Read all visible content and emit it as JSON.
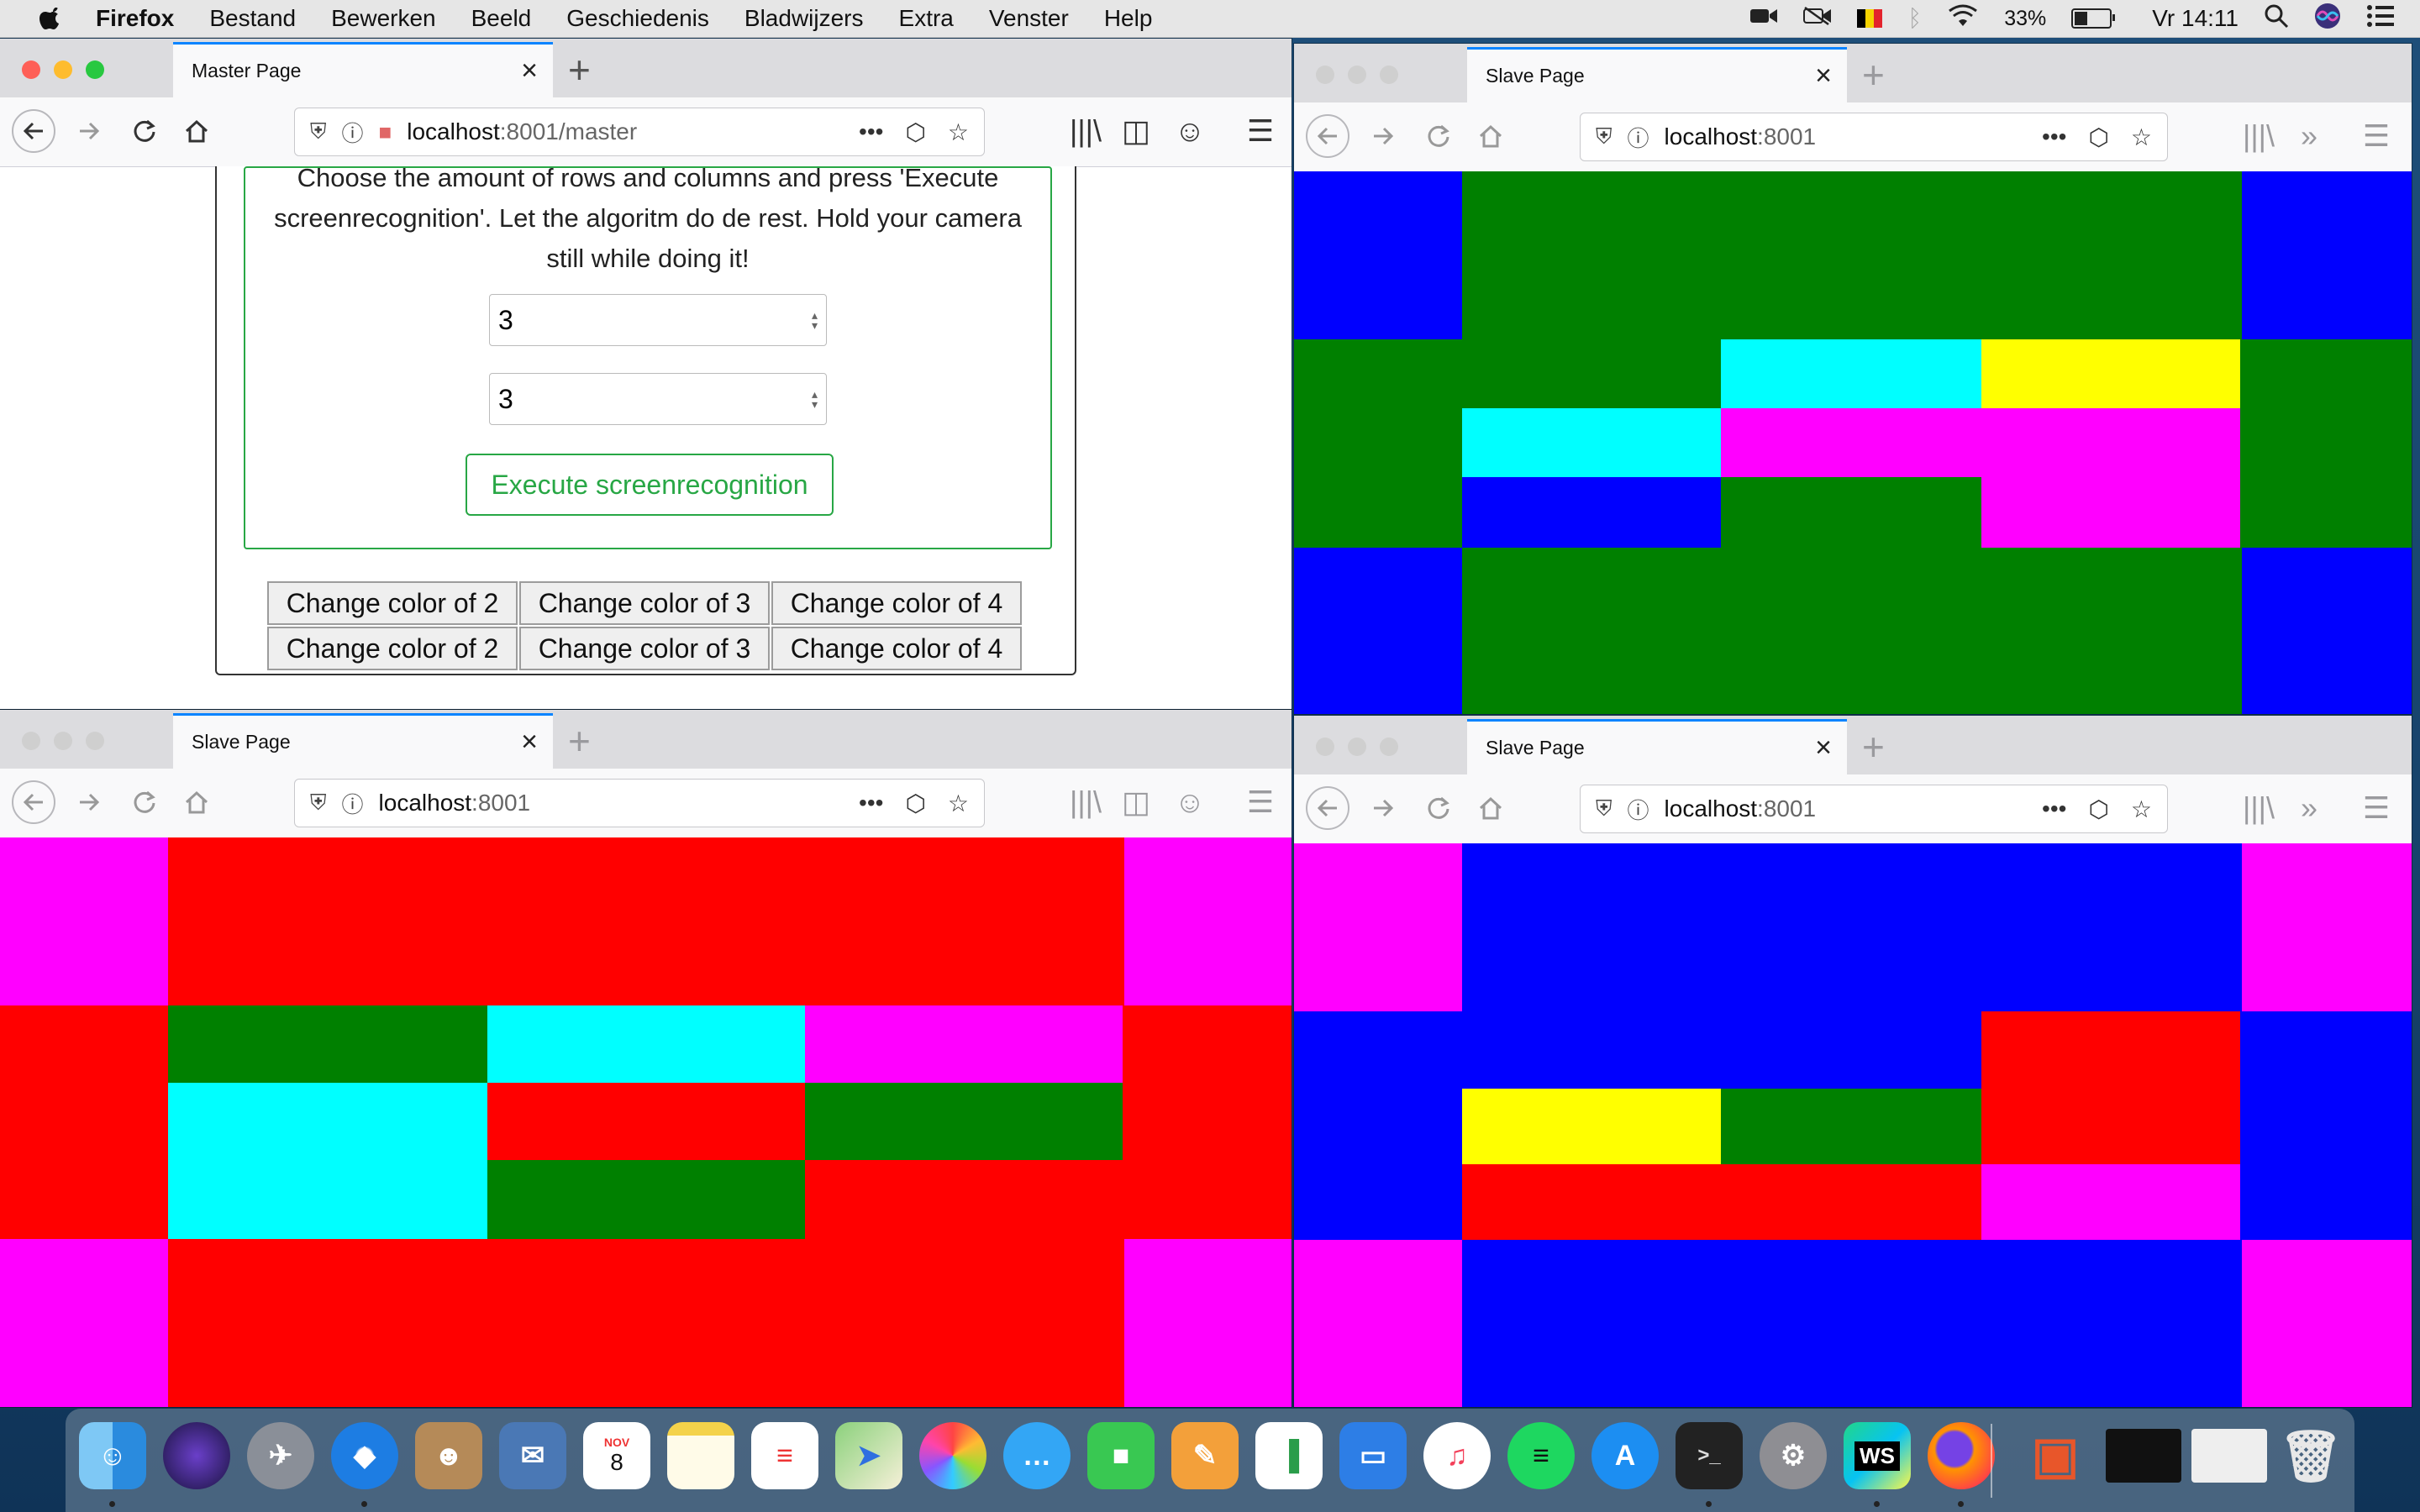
{
  "menubar": {
    "app": "Firefox",
    "items": [
      "Bestand",
      "Bewerken",
      "Beeld",
      "Geschiedenis",
      "Bladwijzers",
      "Extra",
      "Venster",
      "Help"
    ],
    "battery": "33%",
    "clock": "Vr 14:11"
  },
  "windows": {
    "master": {
      "tab_title": "Master Page",
      "url_host": "localhost",
      "url_rest": ":8001/master",
      "instructions_line1": "Choose the amount of rows and columns and press 'Execute",
      "instructions_line2": "screenrecognition'. Let the algoritm do de rest. Hold your camera",
      "instructions_line3": "still while doing it!",
      "rows_value": "3",
      "cols_value": "3",
      "execute_label": "Execute screenrecognition",
      "color_buttons": [
        "Change color of 2",
        "Change color of 3",
        "Change color of 4",
        "Change color of 2",
        "Change color of 3",
        "Change color of 4"
      ]
    },
    "slave_top_right": {
      "tab_title": "Slave Page",
      "url_host": "localhost",
      "url_rest": ":8001",
      "colors": {
        "blue": "#0000ff",
        "green": "#008000",
        "cyan": "#00ffff",
        "yellow": "#ffff00",
        "magenta": "#ff00ff",
        "red": "#ff0000"
      }
    },
    "slave_bottom_left": {
      "tab_title": "Slave Page",
      "url_host": "localhost",
      "url_rest": ":8001"
    },
    "slave_bottom_right": {
      "tab_title": "Slave Page",
      "url_host": "localhost",
      "url_rest": ":8001"
    }
  },
  "dock": {
    "apps": [
      "Finder",
      "Siri",
      "Launchpad",
      "Safari",
      "Contacts",
      "Mail",
      "Calendar",
      "Notes",
      "Reminders",
      "Maps",
      "Photos",
      "Messages",
      "FaceTime",
      "Pages",
      "Numbers",
      "Keynote",
      "Music",
      "Spotify",
      "App Store",
      "Terminal",
      "System Preferences",
      "WebStorm",
      "Firefox",
      "Office",
      "Terminal window",
      "Screenshot",
      "Trash"
    ],
    "calendar_month": "NOV",
    "calendar_day": "8",
    "webstorm_label": "WS"
  }
}
